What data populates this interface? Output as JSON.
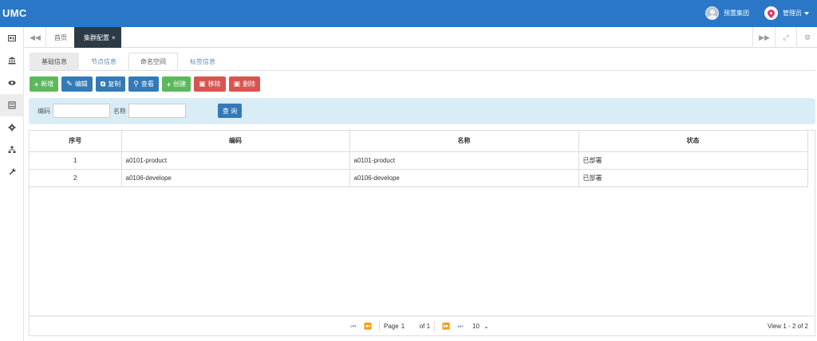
{
  "app": {
    "logo": "UMC"
  },
  "header": {
    "group_name": "预置集团",
    "user_name": "管理员"
  },
  "sidebar": {
    "items": [
      {
        "icon": "id-card-icon"
      },
      {
        "icon": "bank-icon"
      },
      {
        "icon": "eye-icon"
      },
      {
        "icon": "list-icon",
        "active": true
      },
      {
        "icon": "gear-icon"
      },
      {
        "icon": "sitemap-icon"
      },
      {
        "icon": "wrench-icon"
      }
    ]
  },
  "tabbar": {
    "home_label": "首页",
    "current_tab": "集群配置",
    "close_glyph": "×"
  },
  "subtabs": [
    "基础信息",
    "节点信息",
    "命名空间",
    "标签信息"
  ],
  "toolbar": {
    "add": "新增",
    "edit": "编辑",
    "copy": "复制",
    "view": "查看",
    "create": "创建",
    "remove": "移除",
    "delete": "删除"
  },
  "search": {
    "code_label": "编码",
    "name_label": "名称",
    "code_value": "",
    "name_value": "",
    "button": "查 询"
  },
  "table": {
    "columns": [
      "序号",
      "编码",
      "名称",
      "状态"
    ],
    "rows": [
      [
        "1",
        "a0101-product",
        "a0101-product",
        "已部署"
      ],
      [
        "2",
        "a0106-develope",
        "a0106-develope",
        "已部署"
      ]
    ]
  },
  "pager": {
    "page_label": "Page",
    "page_value": "1",
    "of_text": "of 1",
    "page_size": "10",
    "view_info": "View 1 - 2 of 2"
  },
  "colors": {
    "header": "#2a77c7",
    "green": "#5cb85c",
    "blue": "#337ab7",
    "red": "#d9534f",
    "search_bg": "#d9edf7"
  }
}
